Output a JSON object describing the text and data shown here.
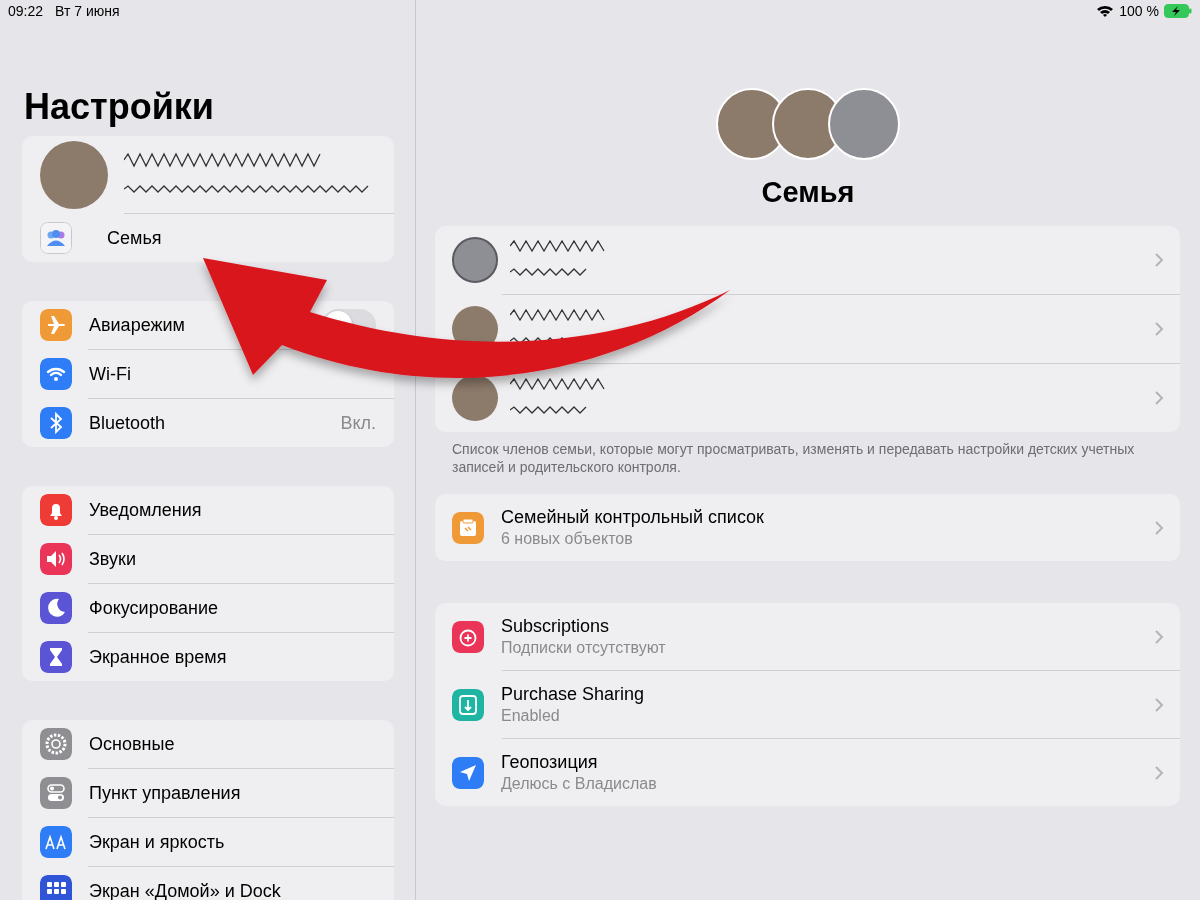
{
  "status_bar": {
    "time": "09:22",
    "date": "Вт 7 июня",
    "battery": "100 %"
  },
  "sidebar": {
    "title": "Настройки",
    "profile": {
      "family_label": "Семья"
    },
    "groups": [
      [
        {
          "label": "Авиарежим",
          "kind": "toggle",
          "on": false
        },
        {
          "label": "Wi-Fi",
          "kind": "plain"
        },
        {
          "label": "Bluetooth",
          "kind": "value",
          "value": "Вкл."
        }
      ],
      [
        {
          "label": "Уведомления",
          "kind": "plain"
        },
        {
          "label": "Звуки",
          "kind": "plain"
        },
        {
          "label": "Фокусирование",
          "kind": "plain"
        },
        {
          "label": "Экранное время",
          "kind": "plain"
        }
      ],
      [
        {
          "label": "Основные",
          "kind": "plain"
        },
        {
          "label": "Пункт управления",
          "kind": "plain"
        },
        {
          "label": "Экран и яркость",
          "kind": "plain"
        },
        {
          "label": "Экран «Домой» и Dock",
          "kind": "plain"
        }
      ]
    ]
  },
  "detail": {
    "avatars": [
      {
        "kind": "photo"
      },
      {
        "kind": "photo"
      },
      {
        "kind": "generic"
      }
    ],
    "title": "Семья",
    "members": [
      {
        "kind": "generic"
      },
      {
        "kind": "photo"
      },
      {
        "kind": "photo"
      }
    ],
    "footnote": "Список членов семьи, которые могут просматривать, изменять и передавать настройки детских учетных записей и родительского контроля.",
    "checklist": {
      "title": "Семейный контрольный список",
      "subtitle": "6 новых объектов"
    },
    "services": [
      {
        "title": "Subscriptions",
        "subtitle": "Подписки отсутствуют"
      },
      {
        "title": "Purchase Sharing",
        "subtitle": "Enabled"
      },
      {
        "title": "Геопозиция",
        "subtitle": "Делюсь с Владислав"
      }
    ]
  },
  "annotation": {
    "kind": "arrow"
  }
}
